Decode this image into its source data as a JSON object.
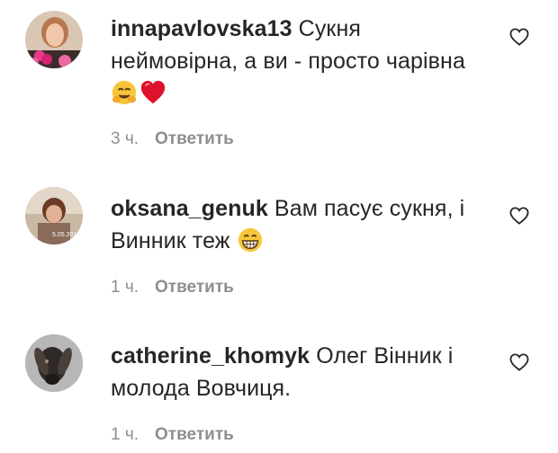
{
  "comments": [
    {
      "username": "innapavlovska13",
      "text_line1": " Сукня",
      "text_line2": "неймовірна, а ви - просто чарівна",
      "emojis": [
        "hugging-face-emoji",
        "red-heart-emoji"
      ],
      "time": "3 ч.",
      "reply_label": "Ответить"
    },
    {
      "username": "oksana_genuk",
      "text_line1": " Вам пасує сукня, і",
      "text_line2": "Винник теж ",
      "emojis": [
        "grinning-face-emoji"
      ],
      "time": "1 ч.",
      "reply_label": "Ответить",
      "avatar_caption": "5.05.2016"
    },
    {
      "username": "catherine_khomyk",
      "text_line1": " Олег Вінник і",
      "text_line2": "молода Вовчиця.",
      "emojis": [],
      "time": "1 ч.",
      "reply_label": "Ответить"
    }
  ],
  "icons": {
    "like": "heart-outline-icon"
  },
  "colors": {
    "text": "#262626",
    "meta": "#8e8e8e",
    "emoji_heart": "#e0112b",
    "emoji_face": "#f7c53a"
  }
}
